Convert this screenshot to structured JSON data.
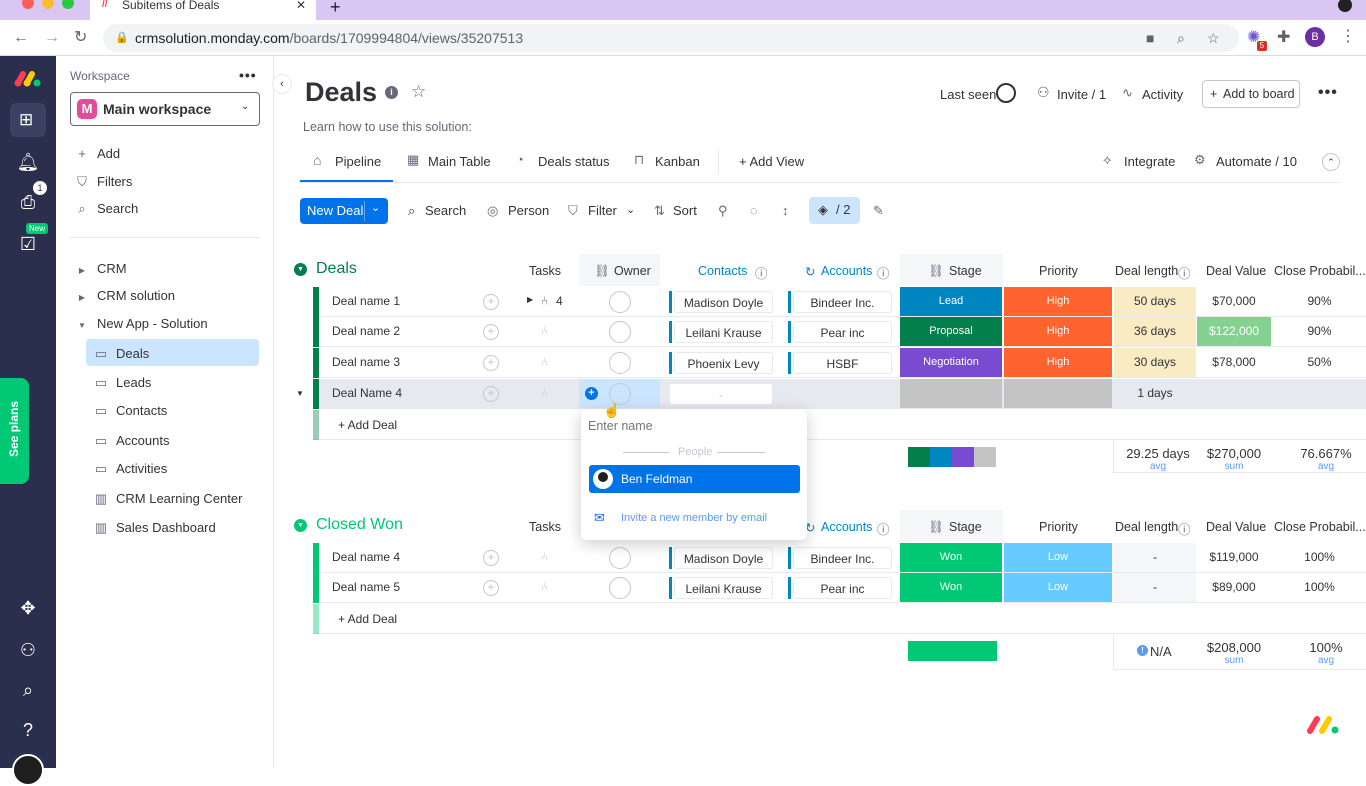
{
  "browser": {
    "tab_title": "Subitems of Deals",
    "url_host": "crmsolution.monday.com",
    "url_path": "/boards/1709994804/views/35207513",
    "new_tab": "+",
    "ext_badge": "5",
    "profile_initial": "B"
  },
  "rail": {
    "inbox_badge": "1",
    "new_badge": "New",
    "see_plans": "See plans"
  },
  "workspace": {
    "label": "Workspace",
    "name": "Main workspace",
    "avatar_letter": "M",
    "actions": [
      {
        "label": "Add",
        "icon": "plus-icon"
      },
      {
        "label": "Filters",
        "icon": "filter-icon"
      },
      {
        "label": "Search",
        "icon": "search-icon"
      }
    ],
    "folders": [
      "CRM",
      "CRM solution",
      "New App - Solution"
    ],
    "boards": [
      "Deals",
      "Leads",
      "Contacts",
      "Accounts",
      "Activities",
      "CRM Learning Center",
      "Sales Dashboard"
    ]
  },
  "header": {
    "title": "Deals",
    "description": "Learn how to use this solution:",
    "last_seen": "Last seen",
    "invite": "Invite / 1",
    "activity": "Activity",
    "add_to_board": "Add to board"
  },
  "views": {
    "tabs": [
      "Pipeline",
      "Main Table",
      "Deals status",
      "Kanban"
    ],
    "active": "Pipeline",
    "add_view": "+ Add View",
    "integrate": "Integrate",
    "automate": "Automate / 10"
  },
  "toolbar": {
    "new_deal": "New Deal",
    "search": "Search",
    "person": "Person",
    "filter": "Filter",
    "sort": "Sort",
    "color_count": "/ 2"
  },
  "columns": {
    "tasks": "Tasks",
    "owner": "Owner",
    "contacts": "Contacts",
    "accounts": "Accounts",
    "stage": "Stage",
    "priority": "Priority",
    "deal_length": "Deal length",
    "deal_value": "Deal Value",
    "close_prob": "Close Probabil..."
  },
  "colors": {
    "lead": "#0086c0",
    "proposal": "#037f4c",
    "negotiation": "#784bd1",
    "won": "#00c875",
    "high": "#ff642e",
    "low": "#66ccff",
    "deals_group": "#037f4c",
    "won_group": "#00c875",
    "length_bg": "#f9ebc4",
    "value_highlight": "#9cd326",
    "primary": "#0073ea"
  },
  "groups": [
    {
      "title": "Deals",
      "add_label": "+ Add Deal",
      "rows": [
        {
          "name": "Deal name 1",
          "subitems": "4",
          "contact": "Madison Doyle",
          "account": "Bindeer Inc.",
          "stage": "Lead",
          "priority": "High",
          "length": "50 days",
          "value": "$70,000",
          "prob": "90%"
        },
        {
          "name": "Deal name 2",
          "subitems": "",
          "contact": "Leilani Krause",
          "account": "Pear inc",
          "stage": "Proposal",
          "priority": "High",
          "length": "36 days",
          "value": "$122,000",
          "prob": "90%"
        },
        {
          "name": "Deal name 3",
          "subitems": "",
          "contact": "Phoenix Levy",
          "account": "HSBF",
          "stage": "Negotiation",
          "priority": "High",
          "length": "30 days",
          "value": "$78,000",
          "prob": "50%"
        },
        {
          "name": "Deal Name 4",
          "subitems": "",
          "contact": "-",
          "account": "",
          "stage": "",
          "priority": "",
          "length": "1 days",
          "value": "",
          "prob": ""
        }
      ],
      "summary": {
        "length": "29.25 days",
        "length_sub": "avg",
        "value": "$270,000",
        "value_sub": "sum",
        "prob": "76.667%",
        "prob_sub": "avg"
      }
    },
    {
      "title": "Closed Won",
      "add_label": "+ Add Deal",
      "rows": [
        {
          "name": "Deal name 4",
          "contact": "Madison Doyle",
          "account": "Bindeer Inc.",
          "stage": "Won",
          "priority": "Low",
          "length": "-",
          "value": "$119,000",
          "prob": "100%"
        },
        {
          "name": "Deal name 5",
          "contact": "Leilani Krause",
          "account": "Pear inc",
          "stage": "Won",
          "priority": "Low",
          "length": "-",
          "value": "$89,000",
          "prob": "100%"
        }
      ],
      "summary": {
        "length": "N/A",
        "value": "$208,000",
        "value_sub": "sum",
        "prob": "100%",
        "prob_sub": "avg"
      }
    }
  ],
  "people_picker": {
    "placeholder": "Enter name",
    "section": "People",
    "person": "Ben Feldman",
    "invite": "Invite a new member by email"
  }
}
